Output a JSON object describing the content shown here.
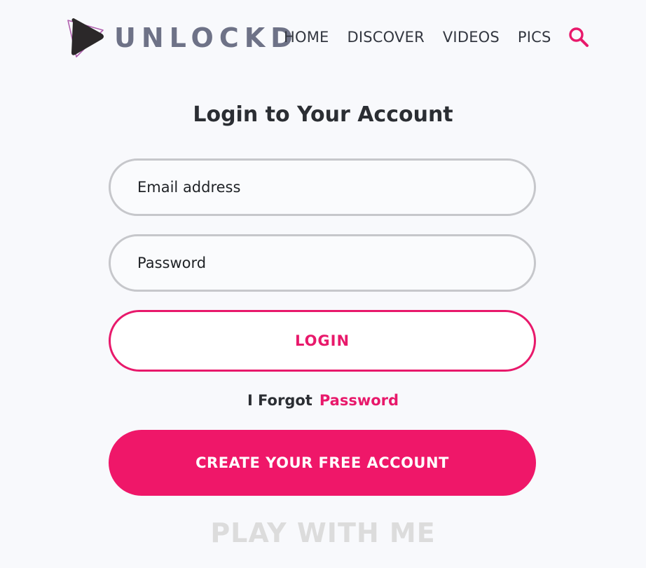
{
  "brand": {
    "name": "UNLOCKD"
  },
  "nav": {
    "items": [
      "HOME",
      "DISCOVER",
      "VIDEOS",
      "PICS"
    ]
  },
  "login": {
    "title": "Login to Your Account",
    "email_placeholder": "Email address",
    "password_placeholder": "Password",
    "login_label": "LOGIN",
    "forgot_text": "I Forgot",
    "forgot_link": "Password",
    "create_label": "CREATE YOUR FREE ACCOUNT"
  },
  "footer": {
    "tagline": "PLAY WITH ME"
  },
  "colors": {
    "accent": "#e8196b",
    "brand_gray": "#6e7287",
    "background": "#f8f9fc"
  },
  "icons": {
    "logo": "play-triangle-logo-icon",
    "search": "search-icon"
  }
}
